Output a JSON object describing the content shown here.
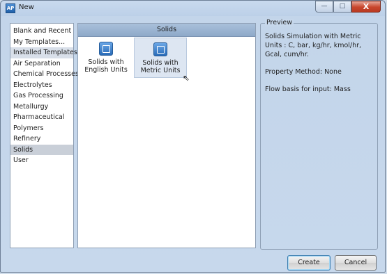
{
  "window": {
    "title": "New",
    "app_icon_text": "AP"
  },
  "title_buttons": {
    "minimize": "—",
    "maximize": "□",
    "close": "X"
  },
  "categories": [
    {
      "label": "Blank and Recent"
    },
    {
      "label": "My Templates..."
    },
    {
      "label": "Installed Templates"
    },
    {
      "label": "Air Separation"
    },
    {
      "label": "Chemical Processes"
    },
    {
      "label": "Electrolytes"
    },
    {
      "label": "Gas Processing"
    },
    {
      "label": "Metallurgy"
    },
    {
      "label": "Pharmaceutical"
    },
    {
      "label": "Polymers"
    },
    {
      "label": "Refinery"
    },
    {
      "label": "Solids"
    },
    {
      "label": "User"
    }
  ],
  "templates_panel": {
    "header": "Solids",
    "items": [
      {
        "label_line1": "Solids with",
        "label_line2": "English Units"
      },
      {
        "label_line1": "Solids with",
        "label_line2": "Metric Units"
      }
    ]
  },
  "preview": {
    "legend": "Preview",
    "description": "Solids Simulation with Metric Units : C, bar, kg/hr, kmol/hr, Gcal, cum/hr.",
    "property_method": "Property Method: None",
    "flow_basis": "Flow basis for input: Mass"
  },
  "buttons": {
    "create": "Create",
    "cancel": "Cancel"
  }
}
